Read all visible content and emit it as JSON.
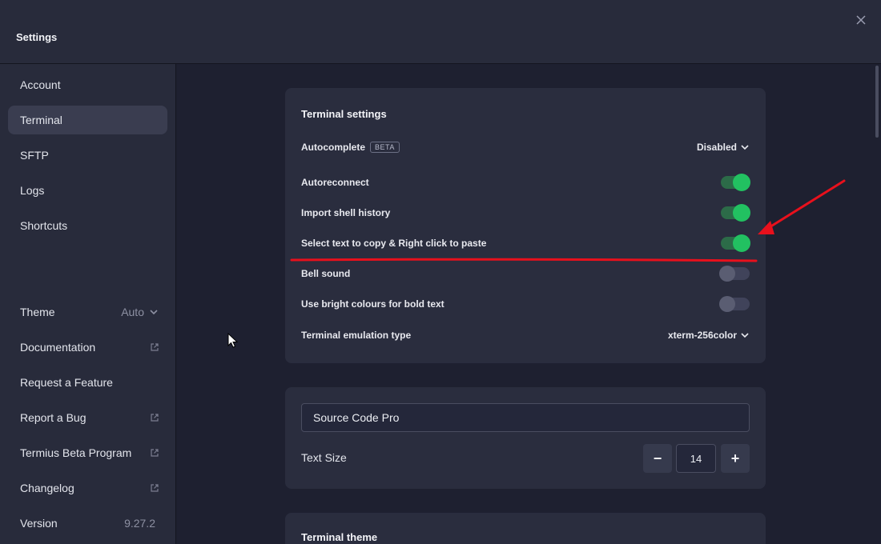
{
  "window": {
    "title": "Settings"
  },
  "sidebar": {
    "items": [
      {
        "label": "Account"
      },
      {
        "label": "Terminal"
      },
      {
        "label": "SFTP"
      },
      {
        "label": "Logs"
      },
      {
        "label": "Shortcuts"
      }
    ],
    "theme": {
      "label": "Theme",
      "value": "Auto"
    },
    "links": [
      {
        "label": "Documentation",
        "icon": "external-link-icon"
      },
      {
        "label": "Request a Feature"
      },
      {
        "label": "Report a Bug",
        "icon": "external-link-icon"
      },
      {
        "label": "Termius Beta Program",
        "icon": "external-link-icon"
      },
      {
        "label": "Changelog",
        "icon": "external-link-icon"
      }
    ],
    "version": {
      "label": "Version",
      "value": "9.27.2"
    }
  },
  "terminal_settings": {
    "title": "Terminal settings",
    "autocomplete": {
      "label": "Autocomplete",
      "badge": "BETA",
      "value": "Disabled"
    },
    "toggles": [
      {
        "label": "Autoreconnect",
        "on": true
      },
      {
        "label": "Import shell history",
        "on": true
      },
      {
        "label": "Select text to copy & Right click to paste",
        "on": true
      },
      {
        "label": "Bell sound",
        "on": false
      },
      {
        "label": "Use bright colours for bold text",
        "on": false
      }
    ],
    "emulation": {
      "label": "Terminal emulation type",
      "value": "xterm-256color"
    }
  },
  "font_settings": {
    "font_family": "Source Code Pro",
    "text_size_label": "Text Size",
    "text_size_value": "14",
    "decrement_label": "−",
    "increment_label": "+"
  },
  "theme_card": {
    "title": "Terminal theme"
  },
  "colors": {
    "toggle_on": "#22c161",
    "annotation": "#e8101c"
  }
}
